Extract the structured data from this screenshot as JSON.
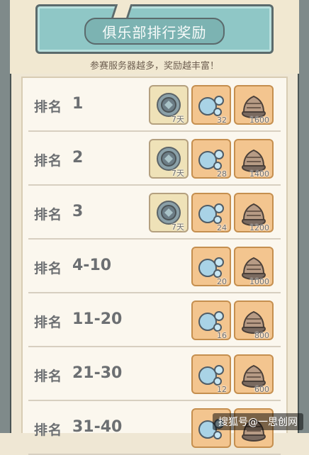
{
  "banner": {
    "title": "俱乐部排行奖励"
  },
  "subtitle": "参赛服务器越多，奖励越丰富！",
  "rank_label": "排名",
  "rows": [
    {
      "rank": "1",
      "items": [
        {
          "icon": "badge-icon",
          "count": "7天"
        },
        {
          "icon": "bubbles-icon",
          "count": "32"
        },
        {
          "icon": "cake-icon",
          "count": "1600"
        }
      ]
    },
    {
      "rank": "2",
      "items": [
        {
          "icon": "badge-icon",
          "count": "7天"
        },
        {
          "icon": "bubbles-icon",
          "count": "28"
        },
        {
          "icon": "cake-icon",
          "count": "1400"
        }
      ]
    },
    {
      "rank": "3",
      "items": [
        {
          "icon": "badge-icon",
          "count": "7天"
        },
        {
          "icon": "bubbles-icon",
          "count": "24"
        },
        {
          "icon": "cake-icon",
          "count": "1200"
        }
      ]
    },
    {
      "rank": "4-10",
      "items": [
        {
          "icon": "bubbles-icon",
          "count": "20"
        },
        {
          "icon": "cake-icon",
          "count": "1000"
        }
      ]
    },
    {
      "rank": "11-20",
      "items": [
        {
          "icon": "bubbles-icon",
          "count": "16"
        },
        {
          "icon": "cake-icon",
          "count": "800"
        }
      ]
    },
    {
      "rank": "21-30",
      "items": [
        {
          "icon": "bubbles-icon",
          "count": "12"
        },
        {
          "icon": "cake-icon",
          "count": "600"
        }
      ]
    },
    {
      "rank": "31-40",
      "items": [
        {
          "icon": "bubbles-icon",
          "count": ""
        },
        {
          "icon": "cake-icon",
          "count": ""
        }
      ]
    }
  ],
  "watermark": "搜狐号@一思创网",
  "colors": {
    "banner": "#8fc7c6",
    "item_bg": "#f3c58f",
    "badge_bg": "#efe2b8"
  }
}
